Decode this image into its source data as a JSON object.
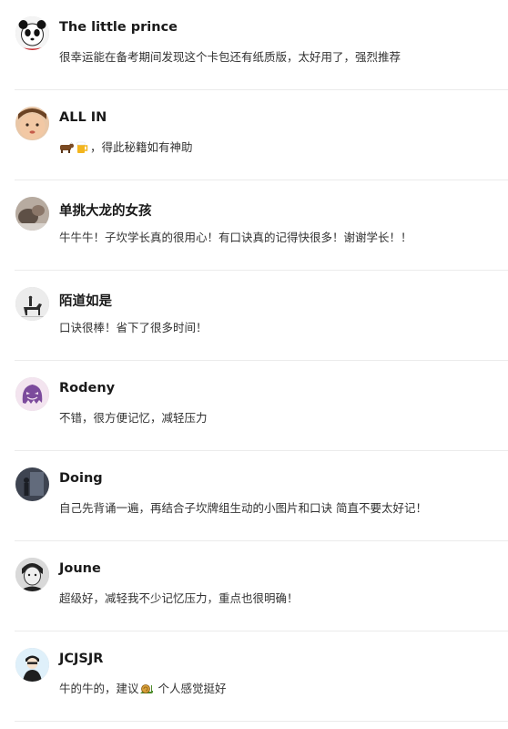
{
  "comments": [
    {
      "user": "The little prince",
      "text": "很幸运能在备考期间发现这个卡包还有纸质版，太好用了，强烈推荐",
      "avatar_icon": "panda-avatar-icon"
    },
    {
      "user": "ALL IN",
      "text_after_icons": "，得此秘籍如有神助",
      "inline_icons": [
        "cow-emoji-icon",
        "beer-emoji-icon"
      ],
      "avatar_icon": "child-avatar-icon"
    },
    {
      "user": "单挑大龙的女孩",
      "text": "牛牛牛！子坎学长真的很用心！有口诀真的记得快很多！谢谢学长！！",
      "avatar_icon": "pet-avatar-icon"
    },
    {
      "user": "陌道如是",
      "text": "口诀很棒！省下了很多时间！",
      "avatar_icon": "horse-rider-avatar-icon"
    },
    {
      "user": "Rodeny",
      "text": "不错，很方便记忆，减轻压力",
      "avatar_icon": "purple-ghost-avatar-icon"
    },
    {
      "user": "Doing",
      "text": "自己先背诵一遍，再结合子坎牌组生动的小图片和口诀 简直不要太好记！",
      "avatar_icon": "silhouette-avatar-icon"
    },
    {
      "user": "Joune",
      "text": "超级好，减轻我不少记忆压力，重点也很明确！",
      "avatar_icon": "sketch-portrait-avatar-icon"
    },
    {
      "user": "JCJSJR",
      "text_before_icon": "牛的牛的，建议",
      "inline_icons": [
        "snail-emoji-icon"
      ],
      "text_after_icon": " 个人感觉挺好",
      "avatar_icon": "cartoon-person-avatar-icon"
    }
  ]
}
